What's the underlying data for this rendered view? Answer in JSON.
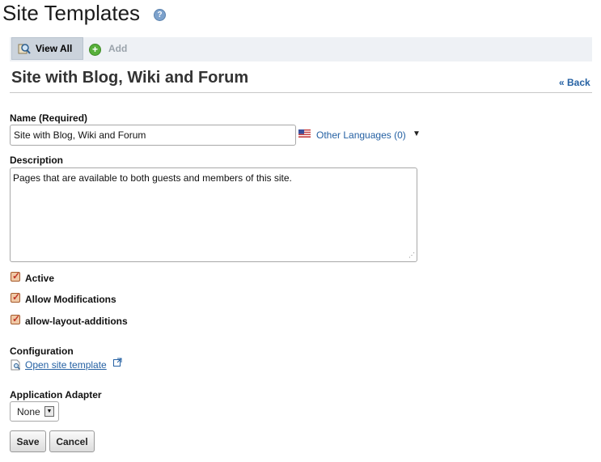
{
  "page": {
    "title": "Site Templates"
  },
  "toolbar": {
    "view_all": "View All",
    "add": "Add"
  },
  "section": {
    "title": "Site with Blog, Wiki and Forum",
    "back": "« Back"
  },
  "form": {
    "name_label": "Name (Required)",
    "name_value": "Site with Blog, Wiki and Forum",
    "other_languages": "Other Languages (0)",
    "description_label": "Description",
    "description_value": "Pages that are available to both guests and members of this site.",
    "checkboxes": [
      {
        "label": "Active",
        "checked": true
      },
      {
        "label": "Allow Modifications",
        "checked": true
      },
      {
        "label": "allow-layout-additions",
        "checked": true
      }
    ],
    "configuration_label": "Configuration",
    "open_template": "Open site template",
    "adapter_label": "Application Adapter",
    "adapter_value": "None"
  },
  "buttons": {
    "save": "Save",
    "cancel": "Cancel"
  },
  "colors": {
    "link": "#2561a3",
    "checkbox_fill": "#f0c9a6",
    "add_green": "#58b03b"
  }
}
